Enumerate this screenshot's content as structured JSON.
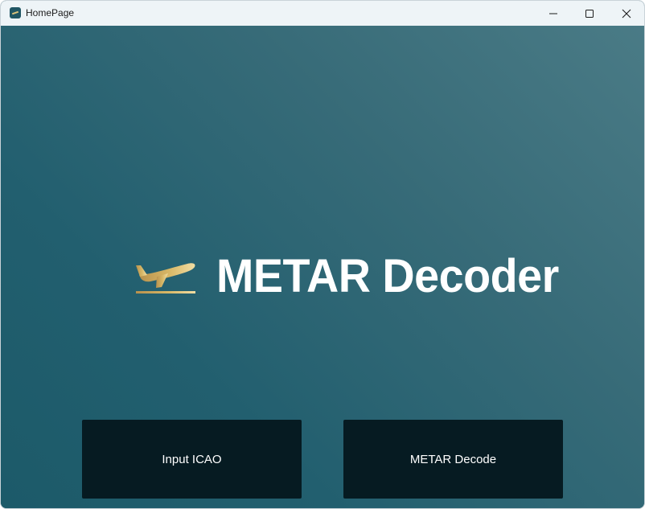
{
  "window": {
    "title": "HomePage",
    "app_icon": "app-logo-icon",
    "controls": {
      "minimize_icon": "minimize-icon",
      "maximize_icon": "maximize-icon",
      "close_icon": "close-icon"
    }
  },
  "hero": {
    "icon": "airplane-takeoff-icon",
    "title": "METAR Decoder"
  },
  "actions": {
    "input_icao_label": "Input ICAO",
    "metar_decode_label": "METAR Decode"
  },
  "colors": {
    "background_gradient_start": "#1c5a69",
    "background_gradient_end": "#4a7b86",
    "button_background": "#061b22",
    "title_color": "#ffffff",
    "plane_gold": "#d8b867"
  }
}
